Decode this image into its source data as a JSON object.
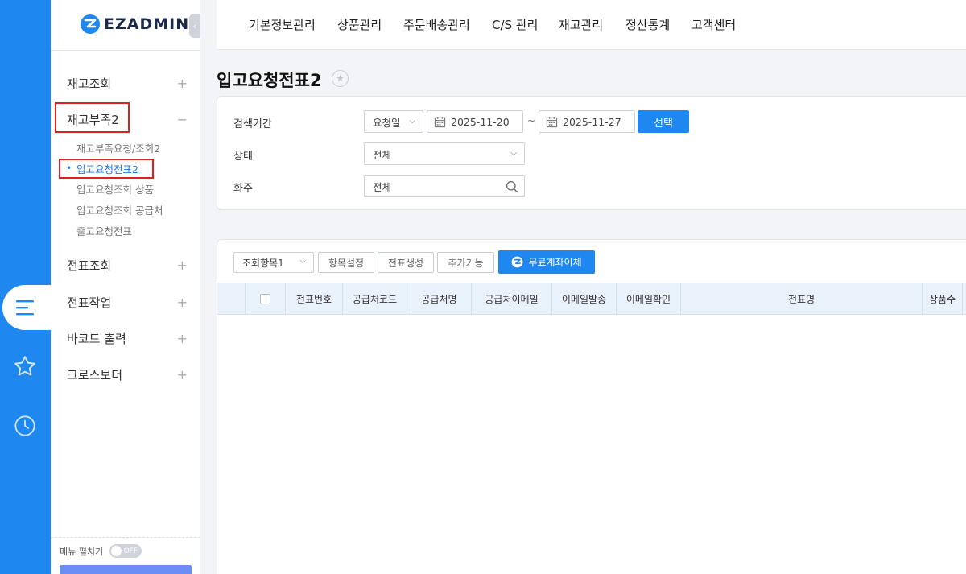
{
  "app": {
    "logo_text": "EZADMIN"
  },
  "topnav": {
    "items": [
      "기본정보관리",
      "상품관리",
      "주문배송관리",
      "C/S 관리",
      "재고관리",
      "정산통계",
      "고객센터"
    ]
  },
  "sidebar": {
    "menus": [
      {
        "label": "재고조회",
        "toggle": "+"
      },
      {
        "label": "재고부족2",
        "toggle": "−"
      },
      {
        "label": "전표조회",
        "toggle": "+"
      },
      {
        "label": "전표작업",
        "toggle": "+"
      },
      {
        "label": "바코드 출력",
        "toggle": "+"
      },
      {
        "label": "크로스보더",
        "toggle": "+"
      }
    ],
    "submenus": [
      "재고부족요청/조회2",
      "입고요청전표2",
      "입고요청조회 상품",
      "입고요청조회 공급처",
      "출고요청전표"
    ],
    "footer": {
      "label": "메뉴 펼치기",
      "switch_text": "OFF"
    }
  },
  "page": {
    "title": "입고요청전표2"
  },
  "search": {
    "period_label": "검색기간",
    "period_type": "요청일",
    "date_from": "2025-11-20",
    "date_sep": "~",
    "date_to": "2025-11-27",
    "select_button": "선택",
    "status_label": "상태",
    "status_value": "전체",
    "owner_label": "화주",
    "owner_placeholder": "전체"
  },
  "toolbar": {
    "query_items": "조회항목1",
    "item_settings": "항목설정",
    "create_slip": "전표생성",
    "extra": "추가기능",
    "free_transfer": "무료계좌이체"
  },
  "table": {
    "columns": [
      "전표번호",
      "공급처코드",
      "공급처명",
      "공급처이메일",
      "이메일발송",
      "이메일확인",
      "전표명",
      "상품수"
    ]
  },
  "colors": {
    "accent": "#1e88f0",
    "highlight": "#e02020"
  }
}
